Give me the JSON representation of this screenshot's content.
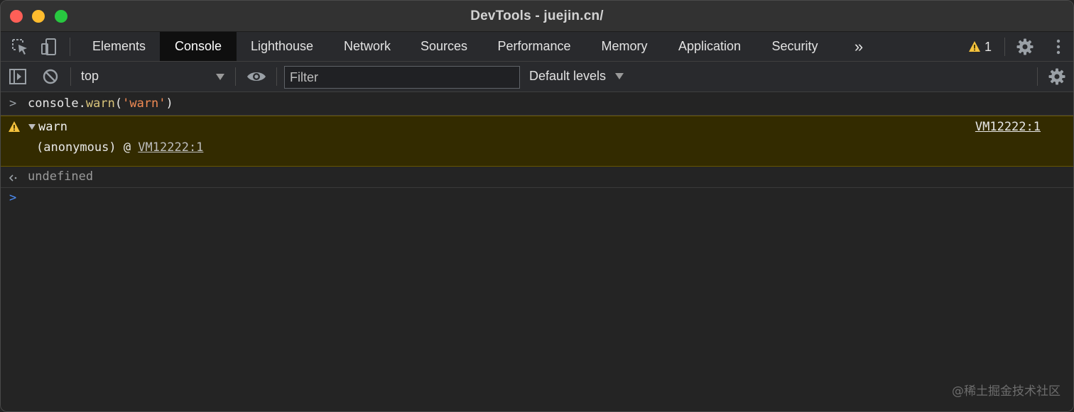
{
  "window": {
    "title": "DevTools - juejin.cn/"
  },
  "tabs": [
    {
      "label": "Elements",
      "active": false
    },
    {
      "label": "Console",
      "active": true
    },
    {
      "label": "Lighthouse",
      "active": false
    },
    {
      "label": "Network",
      "active": false
    },
    {
      "label": "Sources",
      "active": false
    },
    {
      "label": "Performance",
      "active": false
    },
    {
      "label": "Memory",
      "active": false
    },
    {
      "label": "Application",
      "active": false
    },
    {
      "label": "Security",
      "active": false
    }
  ],
  "tabs_bar": {
    "more_tabs_glyph": "»",
    "warning_count": "1",
    "icons": [
      "inspect-element-icon",
      "device-toolbar-icon",
      "warning-icon",
      "settings-gear-icon",
      "kebab-menu-icon"
    ]
  },
  "toolbar": {
    "context": "top",
    "filter_placeholder": "Filter",
    "levels_label": "Default levels",
    "icons": [
      "show-sidebar-icon",
      "clear-console-icon",
      "live-expression-eye-icon",
      "console-settings-gear-icon"
    ]
  },
  "console": {
    "input": {
      "prompt": ">",
      "object": "console",
      "dot": ".",
      "method": "warn",
      "open_paren": "(",
      "argument": "'warn'",
      "close_paren": ")"
    },
    "warning": {
      "message": "warn",
      "source_link": "VM12222:1",
      "stack_frame": "(anonymous) @ ",
      "stack_link": "VM12222:1"
    },
    "result": {
      "value": "undefined"
    },
    "prompt": ">"
  },
  "colors": {
    "warning_background": "#332b00",
    "warning_border": "#665500",
    "warning_icon": "#f4c23d",
    "prompt_blue": "#4d8ef7",
    "active_tab": "#0f0f0f"
  },
  "watermark": "@稀土掘金技术社区"
}
